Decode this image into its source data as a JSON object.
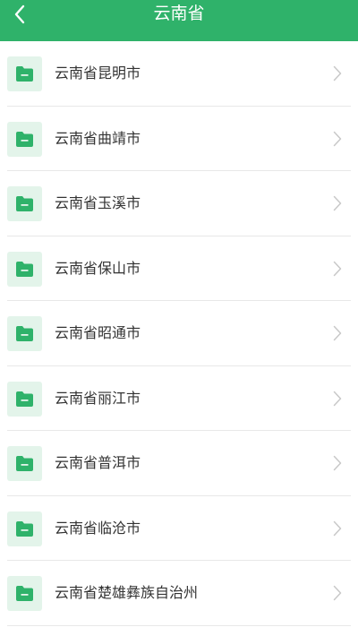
{
  "header": {
    "title": "云南省",
    "back_icon": "chevron-left-icon"
  },
  "colors": {
    "accent": "#2fb26a",
    "icon_bg": "#e3f4ea",
    "text": "#333333",
    "chevron": "#c8c8c8"
  },
  "list": {
    "item_icon": "folder-icon",
    "item_arrow_icon": "chevron-right-icon",
    "items": [
      {
        "label": "云南省昆明市"
      },
      {
        "label": "云南省曲靖市"
      },
      {
        "label": "云南省玉溪市"
      },
      {
        "label": "云南省保山市"
      },
      {
        "label": "云南省昭通市"
      },
      {
        "label": "云南省丽江市"
      },
      {
        "label": "云南省普洱市"
      },
      {
        "label": "云南省临沧市"
      },
      {
        "label": "云南省楚雄彝族自治州"
      }
    ]
  }
}
